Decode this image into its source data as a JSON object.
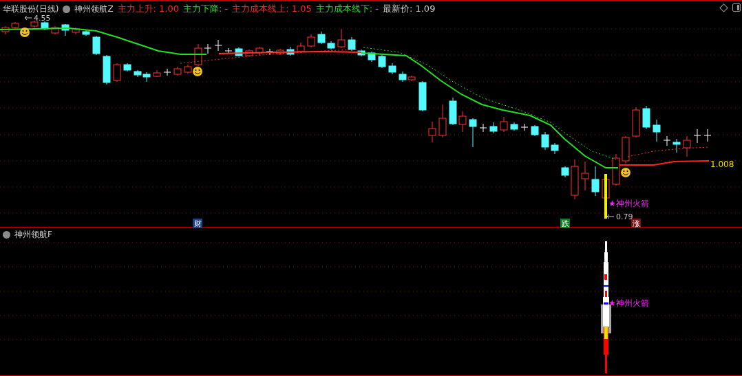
{
  "main_panel": {
    "title": "华联股份(日线)",
    "indicator": "神州领航Z",
    "legend": [
      {
        "label": "主力上升:",
        "value": "1.00",
        "color": "#ff2a2a"
      },
      {
        "label": "主力下降:",
        "value": "-",
        "color": "#22e022"
      },
      {
        "label": "主力成本线上:",
        "value": "1.05",
        "color": "#ff2a2a"
      },
      {
        "label": "主力成本线下:",
        "value": "-",
        "color": "#22e022"
      },
      {
        "label": "最新价:",
        "value": "1.09",
        "color": "#c8c8c8"
      }
    ],
    "high_label": "4.55",
    "low_label": "0.79",
    "last_value": "1.008",
    "signal_label": "★神州火箭",
    "markers": [
      {
        "text": "财",
        "color": "#1c3f8c"
      },
      {
        "text": "跌",
        "color": "#137a22"
      },
      {
        "text": "涨",
        "color": "#7a1414"
      }
    ]
  },
  "sub_panel": {
    "indicator": "神州领航F",
    "signal_label": "★神州火箭"
  }
}
